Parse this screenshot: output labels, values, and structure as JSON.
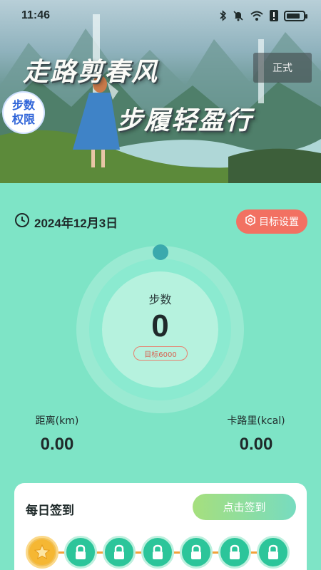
{
  "status_bar": {
    "time": "11:46",
    "icons": [
      "bluetooth-icon",
      "mute-bell-icon",
      "wifi-icon",
      "alert-icon",
      "battery-icon"
    ],
    "battery_level": 0.8
  },
  "banner": {
    "slogan_line1": "走路剪春风",
    "slogan_line2": "步履轻盈行",
    "env_badge": "正式",
    "permission_badge": "步数权限"
  },
  "date": {
    "text": "2024年12月3日",
    "icon": "clock-icon"
  },
  "goal_setting": {
    "label": "目标设置",
    "icon": "settings-icon"
  },
  "steps": {
    "label": "步数",
    "value": "0",
    "goal": "目标6000",
    "progress": 0
  },
  "stats": {
    "distance": {
      "label": "距离(km)",
      "value": "0.00"
    },
    "calories": {
      "label": "卡路里(kcal)",
      "value": "0.00"
    }
  },
  "checkin": {
    "title": "每日签到",
    "button": "点击签到",
    "days": [
      {
        "state": "current",
        "icon": "star-coin-icon"
      },
      {
        "state": "locked",
        "icon": "lock-icon"
      },
      {
        "state": "locked",
        "icon": "lock-icon"
      },
      {
        "state": "locked",
        "icon": "lock-icon"
      },
      {
        "state": "locked",
        "icon": "lock-icon"
      },
      {
        "state": "locked",
        "icon": "lock-icon"
      },
      {
        "state": "locked",
        "icon": "lock-icon"
      }
    ]
  },
  "colors": {
    "page_bg": "#7ee4c6",
    "accent_red": "#f27162",
    "ring_dot": "#3aa9ad",
    "day_locked": "#2cc59a",
    "coin": "#f5b733",
    "track": "#f2a23a"
  }
}
